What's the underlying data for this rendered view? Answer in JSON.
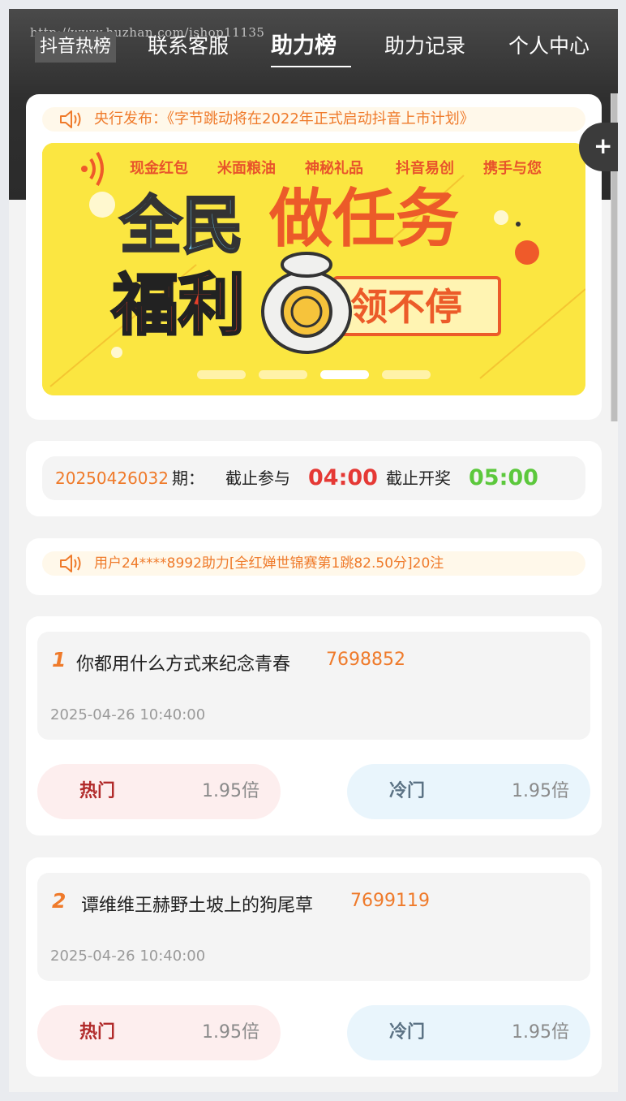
{
  "watermark": "http://www.huzhan.com/ishop11135",
  "nav": {
    "items": [
      "抖音热榜",
      "联系客服",
      "助力榜",
      "助力记录",
      "个人中心"
    ],
    "active_index": 2
  },
  "announcement": {
    "icon": "speaker-icon",
    "text": "央行发布：《字节跳动将在2022年正式启动抖音上市计划》"
  },
  "banner": {
    "tags": [
      "现金红包",
      "米面粮油",
      "神秘礼品",
      "抖音易创",
      "携手与您"
    ],
    "headline_part1": "全民",
    "headline_part2": "做任务",
    "sub_part1": "福利",
    "sub_part2": "领不停",
    "slides": 4,
    "active_slide": 3
  },
  "fab_label": "+",
  "period": {
    "number": "20250426032",
    "suffix": "期：",
    "join_label": "截止参与",
    "join_time": "04:00",
    "draw_label": "截止开奖",
    "draw_time": "05:00"
  },
  "ticker": {
    "icon": "speaker-icon",
    "text": "用户24****8992助力[全红婵世锦赛第1跳82.50分]20注"
  },
  "topics": [
    {
      "rank": "1",
      "title": "你都用什么方式来纪念青春",
      "count": "7698852",
      "time": "2025-04-26 10:40:00",
      "hot_label": "热门",
      "hot_odds": "1.95倍",
      "cold_label": "冷门",
      "cold_odds": "1.95倍"
    },
    {
      "rank": "2",
      "title": "谭维维王赫野土坡上的狗尾草",
      "count": "7699119",
      "time": "2025-04-26 10:40:00",
      "hot_label": "热门",
      "hot_odds": "1.95倍",
      "cold_label": "冷门",
      "cold_odds": "1.95倍"
    }
  ],
  "colors": {
    "accent_orange": "#ef7a2a",
    "join_time_red": "#e53935",
    "draw_time_green": "#5cc83c",
    "banner_yellow": "#fbe641"
  }
}
